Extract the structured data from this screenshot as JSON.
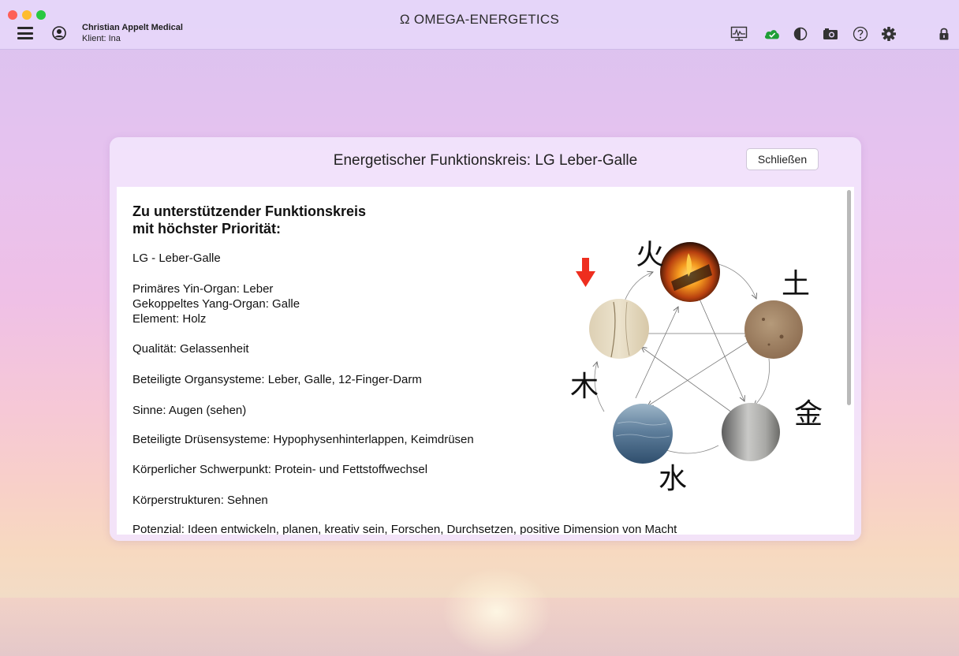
{
  "window": {
    "app_title": "Ω OMEGA-ENERGETICS",
    "company": "Christian Appelt Medical",
    "client": "Klient: Ina"
  },
  "toolbar": {
    "icons": [
      "monitor-icon",
      "cloud-sync-icon",
      "contrast-icon",
      "camera-icon",
      "help-icon",
      "settings-icon",
      "lock-icon"
    ],
    "cloud_color": "#1f9e37"
  },
  "dialog": {
    "title": "Energetischer Funktionskreis: LG Leber-Galle",
    "close_label": "Schließen",
    "heading_line1": "Zu unterstützender Funktionskreis",
    "heading_line2": "mit höchster Priorität:",
    "lines": {
      "name": "LG - Leber-Galle",
      "yin": "Primäres Yin-Organ: Leber",
      "yang": "Gekoppeltes Yang-Organ: Galle",
      "element": "Element: Holz",
      "quality": "Qualität: Gelassenheit",
      "organ_systems": "Beteiligte Organsysteme: Leber, Galle, 12-Finger-Darm",
      "senses": "Sinne: Augen (sehen)",
      "glands": "Beteiligte Drüsensysteme: Hypophysenhinterlappen, Keimdrüsen",
      "focus": "Körperlicher Schwerpunkt: Protein- und Fettstoffwechsel",
      "structures": "Körperstrukturen: Sehnen",
      "potential": "Potenzial: Ideen entwickeln, planen, kreativ sein, Forschen, Durchsetzen, positive Dimension von Macht"
    }
  },
  "elements": {
    "fire": "火",
    "earth": "土",
    "metal": "金",
    "water": "水",
    "wood": "木"
  },
  "accent_colors": {
    "priority_arrow": "#ee2e1f"
  }
}
